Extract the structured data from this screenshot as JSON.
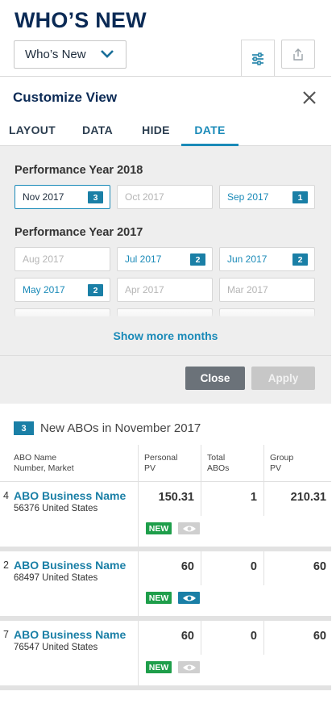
{
  "header": {
    "title": "WHO’S NEW",
    "view_select": "Who’s New"
  },
  "customize": {
    "title": "Customize View",
    "tabs": [
      "LAYOUT",
      "DATA",
      "HIDE",
      "DATE"
    ],
    "active_tab": "DATE",
    "year2018": {
      "title": "Performance Year 2018",
      "months": [
        {
          "label": "Nov 2017",
          "count": "3",
          "state": "current"
        },
        {
          "label": "Oct 2017",
          "count": "",
          "state": "disabled"
        },
        {
          "label": "Sep 2017",
          "count": "1",
          "state": "available"
        }
      ]
    },
    "year2017": {
      "title": "Performance Year 2017",
      "months": [
        {
          "label": "Aug 2017",
          "count": "",
          "state": "disabled"
        },
        {
          "label": "Jul 2017",
          "count": "2",
          "state": "available"
        },
        {
          "label": "Jun 2017",
          "count": "2",
          "state": "available"
        },
        {
          "label": "May 2017",
          "count": "2",
          "state": "available"
        },
        {
          "label": "Apr 2017",
          "count": "",
          "state": "disabled"
        },
        {
          "label": "Mar 2017",
          "count": "",
          "state": "disabled"
        }
      ]
    },
    "show_more": "Show more months",
    "close_label": "Close",
    "apply_label": "Apply"
  },
  "summary": {
    "count": "3",
    "text": "New ABOs in November 2017"
  },
  "table": {
    "columns": [
      "ABO Name\nNumber, Market",
      "Personal\nPV",
      "Total\nABOs",
      "Group\nPV"
    ],
    "rows": [
      {
        "rank": "4",
        "name": "ABO Business Name",
        "number_market": "56376  United States",
        "personal_pv": "150.31",
        "total_abos": "1",
        "group_pv": "210.31",
        "badge": "NEW",
        "watched": false
      },
      {
        "rank": "2",
        "name": "ABO Business Name",
        "number_market": "68497  United States",
        "personal_pv": "60",
        "total_abos": "0",
        "group_pv": "60",
        "badge": "NEW",
        "watched": true
      },
      {
        "rank": "7",
        "name": "ABO Business Name",
        "number_market": "76547  United States",
        "personal_pv": "60",
        "total_abos": "0",
        "group_pv": "60",
        "badge": "NEW",
        "watched": false
      }
    ]
  },
  "colors": {
    "brand_navy": "#0b2a55",
    "accent_blue": "#1a8ab8",
    "badge_green": "#1e9e4a"
  }
}
